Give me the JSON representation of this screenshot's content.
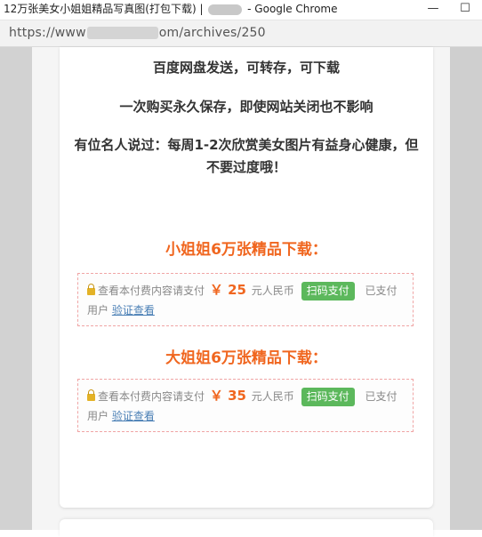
{
  "window": {
    "title_prefix": "12万张美女小姐姐精品写真图(打包下载) |",
    "title_suffix": "- Google Chrome",
    "minimize_glyph": "—",
    "maximize_glyph": "☐"
  },
  "address": {
    "prefix": "https://www",
    "suffix": "om/archives/250"
  },
  "content": {
    "line1": "百度网盘发送，可转存，可下载",
    "line2": "一次购买永久保存，即使网站关闭也不影响",
    "line3": "有位名人说过：每周1-2次欣赏美女图片有益身心健康，但不要过度哦！"
  },
  "sections": [
    {
      "heading": "小姐姐6万张精品下载：",
      "notice": "查看本付费内容请支付",
      "price": "￥ 25",
      "currency": "元人民币",
      "pay_button": "扫码支付",
      "paid_prefix": "已支付用户",
      "verify_link": "验证查看"
    },
    {
      "heading": "大姐姐6万张精品下载：",
      "notice": "查看本付费内容请支付",
      "price": "￥ 35",
      "currency": "元人民币",
      "pay_button": "扫码支付",
      "paid_prefix": "已支付用户",
      "verify_link": "验证查看"
    }
  ],
  "colors": {
    "accent": "#f0661f",
    "pay_button": "#5cb85c",
    "link": "#4a7fb5"
  }
}
